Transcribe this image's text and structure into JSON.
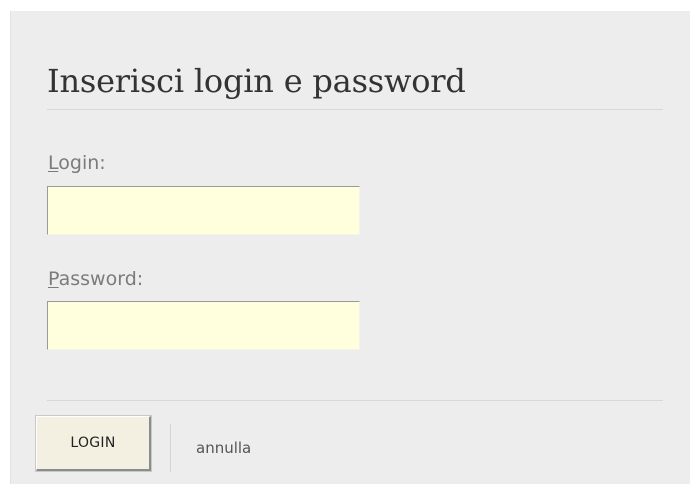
{
  "form": {
    "title": "Inserisci login e password",
    "login": {
      "label_key": "L",
      "label_rest": "ogin:",
      "value": ""
    },
    "password": {
      "label_key": "P",
      "label_rest": "assword:",
      "value": ""
    },
    "submit_label": "LOGIN",
    "cancel_label": "annulla"
  },
  "colors": {
    "panel_background": "#ededed",
    "input_background": "#ffffdd",
    "button_background": "#f3efe1",
    "title_text": "#333333",
    "label_text": "#7b7b7b"
  }
}
